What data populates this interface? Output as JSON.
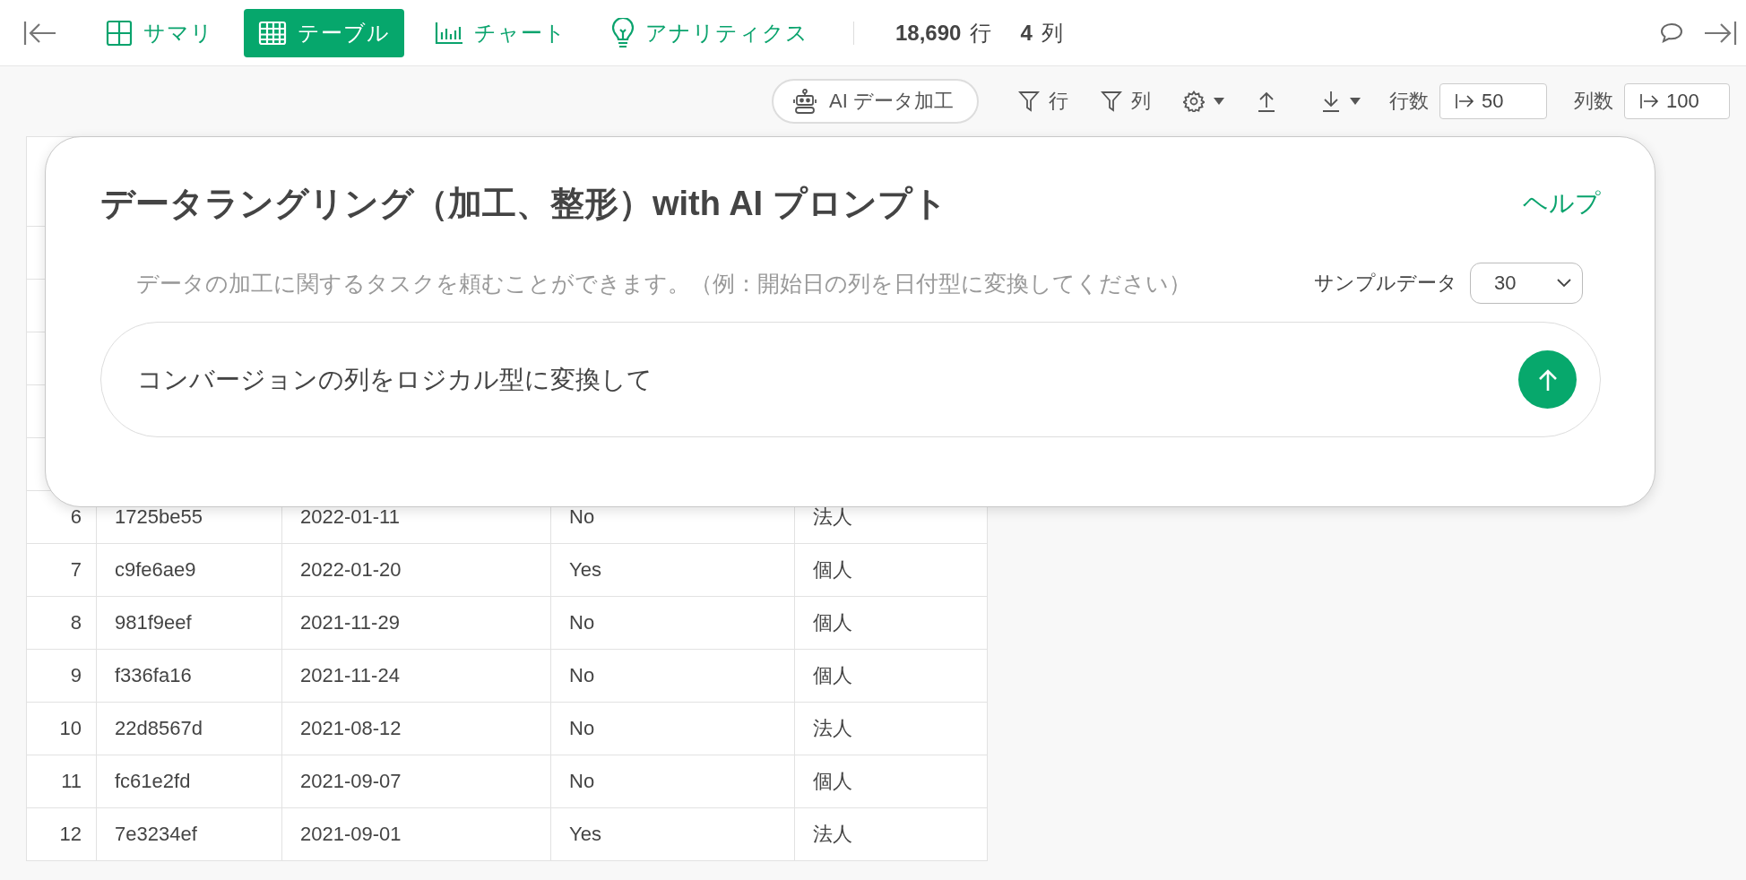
{
  "top_bar": {
    "tabs": [
      {
        "label": "サマリ",
        "selected": false
      },
      {
        "label": "テーブル",
        "selected": true
      },
      {
        "label": "チャート",
        "selected": false
      },
      {
        "label": "アナリティクス",
        "selected": false
      }
    ],
    "row_count": {
      "value": "18,690",
      "unit": "行"
    },
    "column_count": {
      "value": "4",
      "unit": "列"
    }
  },
  "toolbar": {
    "ai_button": "AI データ加工",
    "actions": [
      {
        "kind": "filter",
        "label": "行"
      },
      {
        "kind": "filter",
        "label": "列"
      },
      {
        "kind": "settings"
      },
      {
        "kind": "upload"
      },
      {
        "kind": "download"
      }
    ],
    "rows_setting": {
      "label": "行数",
      "value": "50"
    },
    "columns_setting": {
      "label": "列数",
      "value": "100"
    }
  },
  "table": {
    "rows": [
      {
        "index": "6",
        "cells": [
          "1725be55",
          "2022-01-11",
          "No",
          "法人"
        ]
      },
      {
        "index": "7",
        "cells": [
          "c9fe6ae9",
          "2022-01-20",
          "Yes",
          "個人"
        ]
      },
      {
        "index": "8",
        "cells": [
          "981f9eef",
          "2021-11-29",
          "No",
          "個人"
        ]
      },
      {
        "index": "9",
        "cells": [
          "f336fa16",
          "2021-11-24",
          "No",
          "個人"
        ]
      },
      {
        "index": "10",
        "cells": [
          "22d8567d",
          "2021-08-12",
          "No",
          "法人"
        ]
      },
      {
        "index": "11",
        "cells": [
          "fc61e2fd",
          "2021-09-07",
          "No",
          "個人"
        ]
      },
      {
        "index": "12",
        "cells": [
          "7e3234ef",
          "2021-09-01",
          "Yes",
          "法人"
        ]
      }
    ]
  },
  "dialog": {
    "title": "データラングリング（加工、整形）with AI プロンプト",
    "help_link": "ヘルプ",
    "description": "データの加工に関するタスクを頼むことができます。（例：開始日の列を日付型に変換してください）",
    "sample": {
      "label": "サンプルデータ",
      "value": "30"
    },
    "prompt": "コンバージョンの列をロジカル型に変換して"
  }
}
